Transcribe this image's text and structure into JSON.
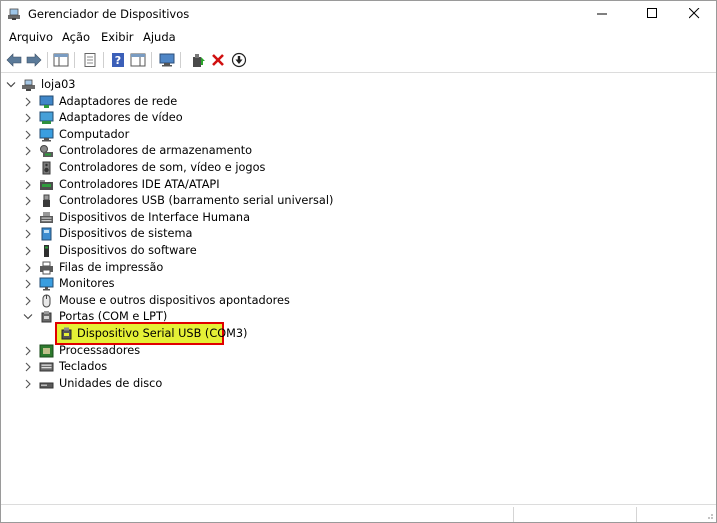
{
  "window": {
    "title": "Gerenciador de Dispositivos",
    "controls": [
      "minimize",
      "maximize",
      "close"
    ]
  },
  "menu": {
    "items": [
      "Arquivo",
      "Ação",
      "Exibir",
      "Ajuda"
    ]
  },
  "toolbar": {
    "buttons": [
      "back-icon",
      "forward-icon",
      "show-hide-console-tree-icon",
      "properties-icon",
      "help-icon",
      "action-pane-icon",
      "scan-hardware-icon",
      "update-driver-icon",
      "uninstall-icon",
      "disable-icon"
    ]
  },
  "tree": {
    "root": "loja03",
    "categories": [
      "Adaptadores de rede",
      "Adaptadores de vídeo",
      "Computador",
      "Controladores de armazenamento",
      "Controladores de som, vídeo e jogos",
      "Controladores IDE ATA/ATAPI",
      "Controladores USB (barramento serial universal)",
      "Dispositivos de Interface Humana",
      "Dispositivos de sistema",
      "Dispositivos do software",
      "Filas de impressão",
      "Monitores",
      "Mouse e outros dispositivos apontadores",
      "Portas (COM e LPT)",
      "Processadores",
      "Teclados",
      "Unidades de disco"
    ],
    "expanded_category": "Portas (COM e LPT)",
    "selected_device": "Dispositivo Serial USB (COM3)"
  },
  "colors": {
    "highlight_fill": "#e5f036",
    "highlight_border": "#e00000",
    "uninstall_red": "#d01010"
  }
}
